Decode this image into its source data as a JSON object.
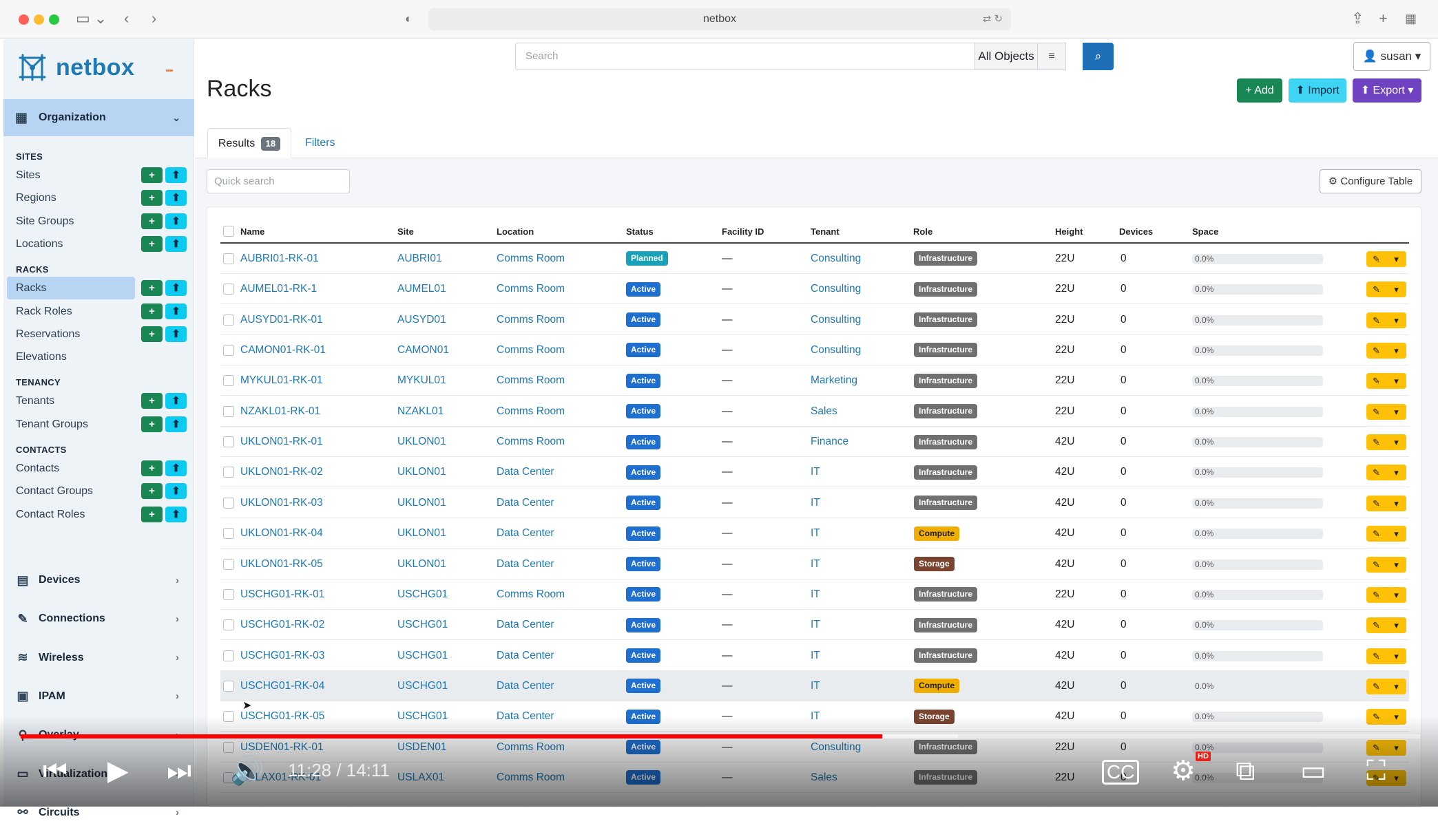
{
  "browser": {
    "url": "netbox"
  },
  "app": {
    "logo_text": "netbox"
  },
  "sidebar": {
    "org_label": "Organization",
    "sections": [
      {
        "title": "SITES",
        "items": [
          {
            "label": "Sites",
            "buttons": true
          },
          {
            "label": "Regions",
            "buttons": true
          },
          {
            "label": "Site Groups",
            "buttons": true
          },
          {
            "label": "Locations",
            "buttons": true
          }
        ]
      },
      {
        "title": "RACKS",
        "items": [
          {
            "label": "Racks",
            "buttons": true,
            "active": true
          },
          {
            "label": "Rack Roles",
            "buttons": true
          },
          {
            "label": "Reservations",
            "buttons": true
          },
          {
            "label": "Elevations",
            "buttons": false
          }
        ]
      },
      {
        "title": "TENANCY",
        "items": [
          {
            "label": "Tenants",
            "buttons": true
          },
          {
            "label": "Tenant Groups",
            "buttons": true
          }
        ]
      },
      {
        "title": "CONTACTS",
        "items": [
          {
            "label": "Contacts",
            "buttons": true
          },
          {
            "label": "Contact Groups",
            "buttons": true
          },
          {
            "label": "Contact Roles",
            "buttons": true
          }
        ]
      }
    ],
    "menus": [
      "Devices",
      "Connections",
      "Wireless",
      "IPAM",
      "Overlay",
      "Virtualization",
      "Circuits"
    ]
  },
  "topbar": {
    "search_placeholder": "Search",
    "scope": "All Objects",
    "user": "susan"
  },
  "page": {
    "title": "Racks",
    "add": "+ Add",
    "import": "⬆ Import",
    "export": "⬆ Export ▾",
    "tab_results": "Results",
    "results_count": "18",
    "tab_filters": "Filters",
    "quick_search_placeholder": "Quick search",
    "configure_table": "⚙ Configure Table"
  },
  "table": {
    "columns": [
      "Name",
      "Site",
      "Location",
      "Status",
      "Facility ID",
      "Tenant",
      "Role",
      "Height",
      "Devices",
      "Space"
    ],
    "rows": [
      {
        "name": "AUBRI01-RK-01",
        "site": "AUBRI01",
        "location": "Comms Room",
        "status": "Planned",
        "facility": "—",
        "tenant": "Consulting",
        "role": "Infrastructure",
        "height": "22U",
        "devices": "0",
        "space": "0.0%"
      },
      {
        "name": "AUMEL01-RK-1",
        "site": "AUMEL01",
        "location": "Comms Room",
        "status": "Active",
        "facility": "—",
        "tenant": "Consulting",
        "role": "Infrastructure",
        "height": "22U",
        "devices": "0",
        "space": "0.0%"
      },
      {
        "name": "AUSYD01-RK-01",
        "site": "AUSYD01",
        "location": "Comms Room",
        "status": "Active",
        "facility": "—",
        "tenant": "Consulting",
        "role": "Infrastructure",
        "height": "22U",
        "devices": "0",
        "space": "0.0%"
      },
      {
        "name": "CAMON01-RK-01",
        "site": "CAMON01",
        "location": "Comms Room",
        "status": "Active",
        "facility": "—",
        "tenant": "Consulting",
        "role": "Infrastructure",
        "height": "22U",
        "devices": "0",
        "space": "0.0%"
      },
      {
        "name": "MYKUL01-RK-01",
        "site": "MYKUL01",
        "location": "Comms Room",
        "status": "Active",
        "facility": "—",
        "tenant": "Marketing",
        "role": "Infrastructure",
        "height": "22U",
        "devices": "0",
        "space": "0.0%"
      },
      {
        "name": "NZAKL01-RK-01",
        "site": "NZAKL01",
        "location": "Comms Room",
        "status": "Active",
        "facility": "—",
        "tenant": "Sales",
        "role": "Infrastructure",
        "height": "22U",
        "devices": "0",
        "space": "0.0%"
      },
      {
        "name": "UKLON01-RK-01",
        "site": "UKLON01",
        "location": "Comms Room",
        "status": "Active",
        "facility": "—",
        "tenant": "Finance",
        "role": "Infrastructure",
        "height": "42U",
        "devices": "0",
        "space": "0.0%"
      },
      {
        "name": "UKLON01-RK-02",
        "site": "UKLON01",
        "location": "Data Center",
        "status": "Active",
        "facility": "—",
        "tenant": "IT",
        "role": "Infrastructure",
        "height": "42U",
        "devices": "0",
        "space": "0.0%"
      },
      {
        "name": "UKLON01-RK-03",
        "site": "UKLON01",
        "location": "Data Center",
        "status": "Active",
        "facility": "—",
        "tenant": "IT",
        "role": "Infrastructure",
        "height": "42U",
        "devices": "0",
        "space": "0.0%"
      },
      {
        "name": "UKLON01-RK-04",
        "site": "UKLON01",
        "location": "Data Center",
        "status": "Active",
        "facility": "—",
        "tenant": "IT",
        "role": "Compute",
        "height": "42U",
        "devices": "0",
        "space": "0.0%"
      },
      {
        "name": "UKLON01-RK-05",
        "site": "UKLON01",
        "location": "Data Center",
        "status": "Active",
        "facility": "—",
        "tenant": "IT",
        "role": "Storage",
        "height": "42U",
        "devices": "0",
        "space": "0.0%"
      },
      {
        "name": "USCHG01-RK-01",
        "site": "USCHG01",
        "location": "Comms Room",
        "status": "Active",
        "facility": "—",
        "tenant": "IT",
        "role": "Infrastructure",
        "height": "22U",
        "devices": "0",
        "space": "0.0%"
      },
      {
        "name": "USCHG01-RK-02",
        "site": "USCHG01",
        "location": "Data Center",
        "status": "Active",
        "facility": "—",
        "tenant": "IT",
        "role": "Infrastructure",
        "height": "42U",
        "devices": "0",
        "space": "0.0%"
      },
      {
        "name": "USCHG01-RK-03",
        "site": "USCHG01",
        "location": "Data Center",
        "status": "Active",
        "facility": "—",
        "tenant": "IT",
        "role": "Infrastructure",
        "height": "42U",
        "devices": "0",
        "space": "0.0%"
      },
      {
        "name": "USCHG01-RK-04",
        "site": "USCHG01",
        "location": "Data Center",
        "status": "Active",
        "facility": "—",
        "tenant": "IT",
        "role": "Compute",
        "height": "42U",
        "devices": "0",
        "space": "0.0%",
        "highlight": true
      },
      {
        "name": "USCHG01-RK-05",
        "site": "USCHG01",
        "location": "Data Center",
        "status": "Active",
        "facility": "—",
        "tenant": "IT",
        "role": "Storage",
        "height": "42U",
        "devices": "0",
        "space": "0.0%"
      },
      {
        "name": "USDEN01-RK-01",
        "site": "USDEN01",
        "location": "Comms Room",
        "status": "Active",
        "facility": "—",
        "tenant": "Consulting",
        "role": "Infrastructure",
        "height": "22U",
        "devices": "0",
        "space": "0.0%"
      },
      {
        "name": "USLAX01-RK-01",
        "site": "USLAX01",
        "location": "Comms Room",
        "status": "Active",
        "facility": "—",
        "tenant": "Sales",
        "role": "Infrastructure",
        "height": "22U",
        "devices": "0",
        "space": "0.0%"
      }
    ]
  },
  "video": {
    "time": "11:28 / 14:11",
    "progress": 0.6155,
    "buffered": 0.67,
    "quality_badge": "HD"
  },
  "colors": {
    "brand": "#1f79b3",
    "add": "#198754",
    "active_status": "#1e6fd0",
    "edit": "#ffc107"
  }
}
